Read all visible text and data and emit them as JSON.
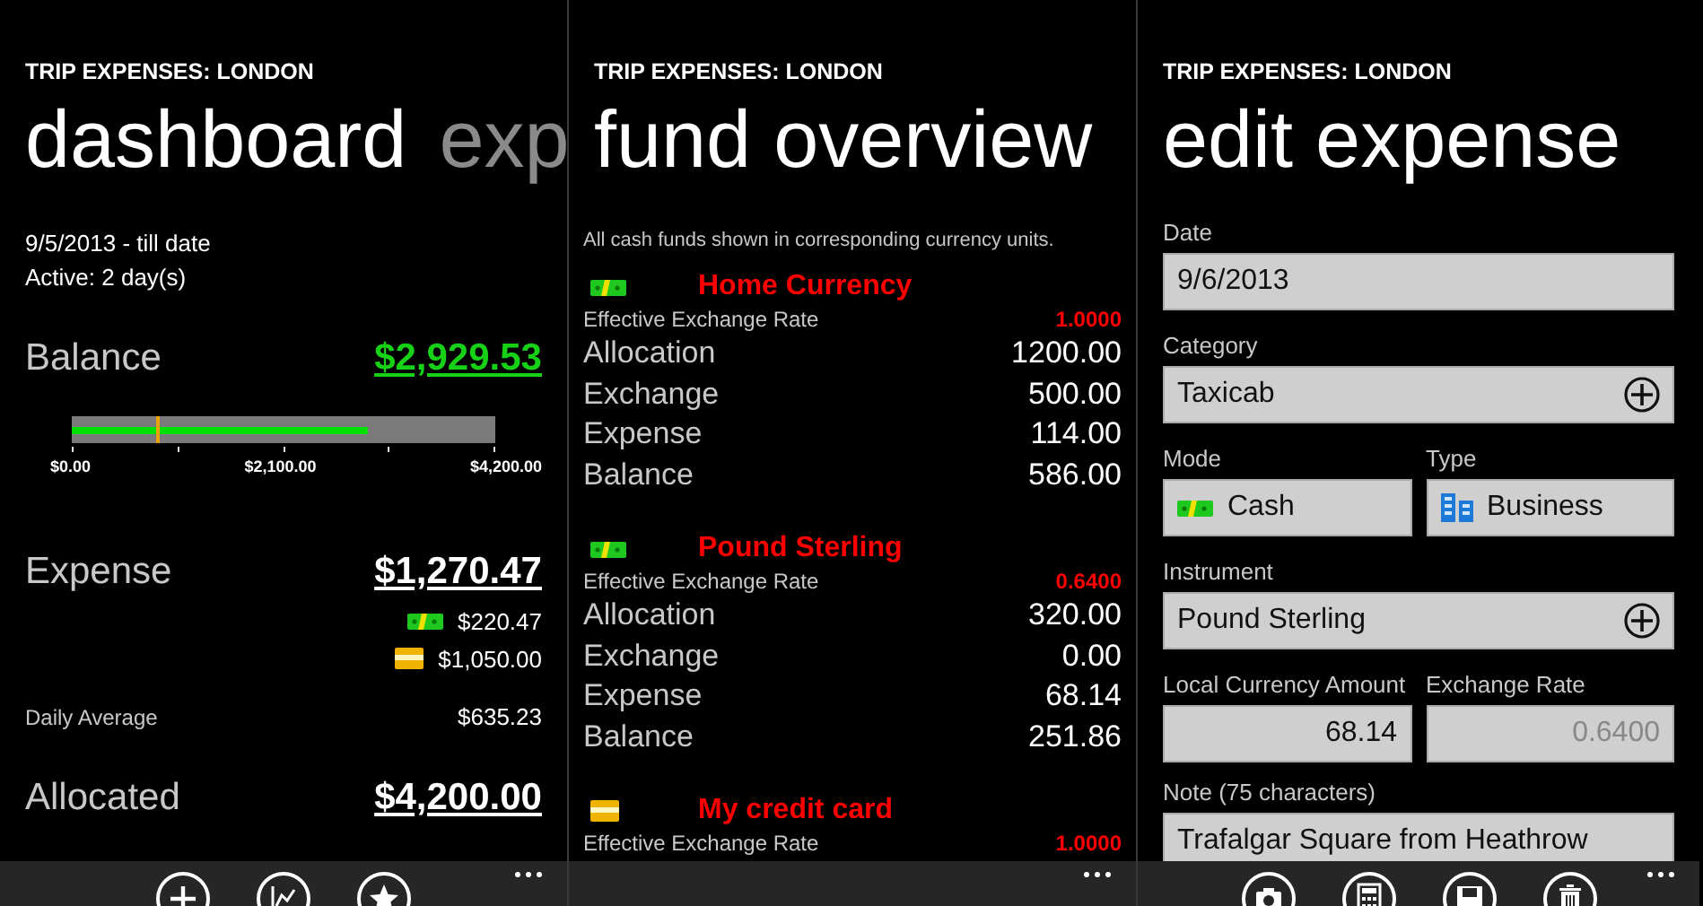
{
  "screens": [
    {
      "kind": "dashboard",
      "app_title": "TRIP EXPENSES: LONDON",
      "pivot_title": "dashboard",
      "next_pivot": "exp",
      "period": "9/5/2013 - till date",
      "active": "Active: 2 day(s)",
      "balance": {
        "label": "Balance",
        "amount": "$2,929.53"
      },
      "gauge": {
        "level": 0.6975,
        "marker": {
          "level": 0.2
        },
        "tick_labels": [
          "$0.00",
          "$2,100.00",
          "$4,200.00"
        ]
      },
      "expense": {
        "label": "Expense",
        "amount": "$1,270.47",
        "breakdown": [
          {
            "kind": "cash",
            "amount": "$220.47"
          },
          {
            "kind": "card",
            "amount": "$1,050.00"
          }
        ]
      },
      "daily_average": {
        "label": "Daily Average",
        "amount": "$635.23"
      },
      "allocated": {
        "label": "Allocated",
        "amount": "$4,200.00"
      },
      "app_bar": [
        {
          "kind": "add"
        },
        {
          "kind": "chart"
        },
        {
          "kind": "star"
        }
      ]
    },
    {
      "kind": "funds",
      "app_title": "TRIP EXPENSES: LONDON",
      "pivot_title": "fund overview",
      "note": "All cash funds shown in corresponding currency units.",
      "funds": [
        {
          "kind": "cash",
          "name": "Home Currency",
          "rate_label": "Effective Exchange Rate",
          "rate": "1.0000",
          "rows": [
            {
              "label": "Allocation",
              "value": "1200.00"
            },
            {
              "label": "Exchange",
              "value": "500.00"
            },
            {
              "label": "Expense",
              "value": "114.00"
            },
            {
              "label": "Balance",
              "value": "586.00"
            }
          ]
        },
        {
          "kind": "cash",
          "name": "Pound Sterling",
          "rate_label": "Effective Exchange Rate",
          "rate": "0.6400",
          "rows": [
            {
              "label": "Allocation",
              "value": "320.00"
            },
            {
              "label": "Exchange",
              "value": "0.00"
            },
            {
              "label": "Expense",
              "value": "68.14"
            },
            {
              "label": "Balance",
              "value": "251.86"
            }
          ]
        },
        {
          "kind": "card",
          "name": "My credit card",
          "rate_label": "Effective Exchange Rate",
          "rate": "1.0000"
        }
      ]
    },
    {
      "kind": "form",
      "app_title": "TRIP EXPENSES: LONDON",
      "pivot_title": "edit expense",
      "fields": [
        {
          "kind": "text",
          "label": "Date",
          "value": "9/6/2013"
        },
        {
          "kind": "picker",
          "label": "Category",
          "value": "Taxicab"
        },
        {
          "kind": "pair",
          "items": [
            {
              "kind": "cash",
              "label": "Mode",
              "value": "Cash"
            },
            {
              "kind": "building",
              "label": "Type",
              "value": "Business"
            }
          ]
        },
        {
          "kind": "picker",
          "label": "Instrument",
          "value": "Pound Sterling"
        },
        {
          "kind": "pair",
          "items": [
            {
              "kind": "number",
              "label": "Local Currency Amount",
              "value": "68.14",
              "disabled": false
            },
            {
              "kind": "number",
              "label": "Exchange Rate",
              "value": "0.6400",
              "disabled": true
            }
          ]
        },
        {
          "kind": "text",
          "label": "Note (75 characters)",
          "value": "Trafalgar Square from Heathrow"
        }
      ],
      "app_bar": [
        {
          "kind": "camera"
        },
        {
          "kind": "calculator"
        },
        {
          "kind": "save"
        },
        {
          "kind": "delete"
        }
      ]
    }
  ]
}
